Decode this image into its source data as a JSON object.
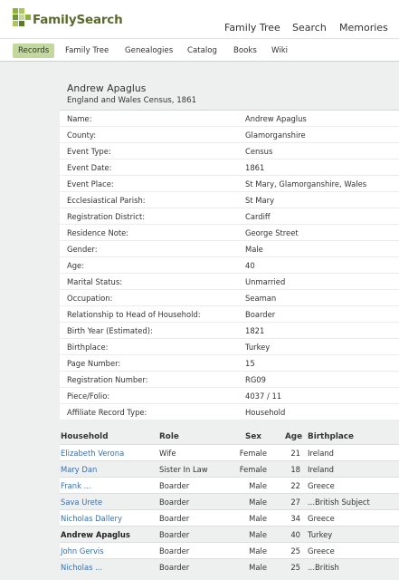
{
  "header": {
    "logo_text": "FamilySearch",
    "nav": [
      "Family Tree",
      "Search",
      "Memories"
    ]
  },
  "subnav": [
    "Records",
    "Family Tree",
    "Genealogies",
    "Catalog",
    "Books",
    "Wiki"
  ],
  "colors": {
    "brand_green": "#5a6b2b",
    "active_tab": "#c3d89e",
    "link": "#3a6eb5"
  },
  "record": {
    "name": "Andrew Apaglus",
    "collection": "England and Wales Census, 1861",
    "facts": [
      {
        "label": "Name:",
        "value": "Andrew Apaglus"
      },
      {
        "label": "County:",
        "value": "Glamorganshire"
      },
      {
        "label": "Event Type:",
        "value": "Census"
      },
      {
        "label": "Event Date:",
        "value": "1861"
      },
      {
        "label": "Event Place:",
        "value": "St Mary, Glamorganshire, Wales"
      },
      {
        "label": "Ecclesiastical Parish:",
        "value": "St Mary"
      },
      {
        "label": "Registration District:",
        "value": "Cardiff"
      },
      {
        "label": "Residence Note:",
        "value": "George Street"
      },
      {
        "label": "Gender:",
        "value": "Male"
      },
      {
        "label": "Age:",
        "value": "40"
      },
      {
        "label": "Marital Status:",
        "value": "Unmarried"
      },
      {
        "label": "Occupation:",
        "value": "Seaman"
      },
      {
        "label": "Relationship to Head of Household:",
        "value": "Boarder"
      },
      {
        "label": "Birth Year (Estimated):",
        "value": "1821"
      },
      {
        "label": "Birthplace:",
        "value": "Turkey"
      },
      {
        "label": "Page Number:",
        "value": "15"
      },
      {
        "label": "Registration Number:",
        "value": "RG09"
      },
      {
        "label": "Piece/Folio:",
        "value": "4037 / 11"
      },
      {
        "label": "Affiliate Record Type:",
        "value": "Household"
      }
    ]
  },
  "household": {
    "headers": {
      "household": "Household",
      "role": "Role",
      "sex": "Sex",
      "age": "Age",
      "birthplace": "Birthplace"
    },
    "members": [
      {
        "name": "Elizabeth Verona",
        "role": "Wife",
        "sex": "Female",
        "age": "21",
        "birthplace": "Ireland",
        "is_self": false
      },
      {
        "name": "Mary Dan",
        "role": "Sister In Law",
        "sex": "Female",
        "age": "18",
        "birthplace": "Ireland",
        "is_self": false
      },
      {
        "name": "Frank ...",
        "role": "Boarder",
        "sex": "Male",
        "age": "22",
        "birthplace": "Greece",
        "is_self": false
      },
      {
        "name": "Sava Urete",
        "role": "Boarder",
        "sex": "Male",
        "age": "27",
        "birthplace": "...British Subject",
        "is_self": false
      },
      {
        "name": "Nicholas Dallery",
        "role": "Boarder",
        "sex": "Male",
        "age": "34",
        "birthplace": "Greece",
        "is_self": false
      },
      {
        "name": "Andrew Apaglus",
        "role": "Boarder",
        "sex": "Male",
        "age": "40",
        "birthplace": "Turkey",
        "is_self": true
      },
      {
        "name": "John Gervis",
        "role": "Boarder",
        "sex": "Male",
        "age": "25",
        "birthplace": "Greece",
        "is_self": false
      },
      {
        "name": "Nicholas ...",
        "role": "Boarder",
        "sex": "Male",
        "age": "25",
        "birthplace": "...British",
        "is_self": false
      }
    ]
  }
}
